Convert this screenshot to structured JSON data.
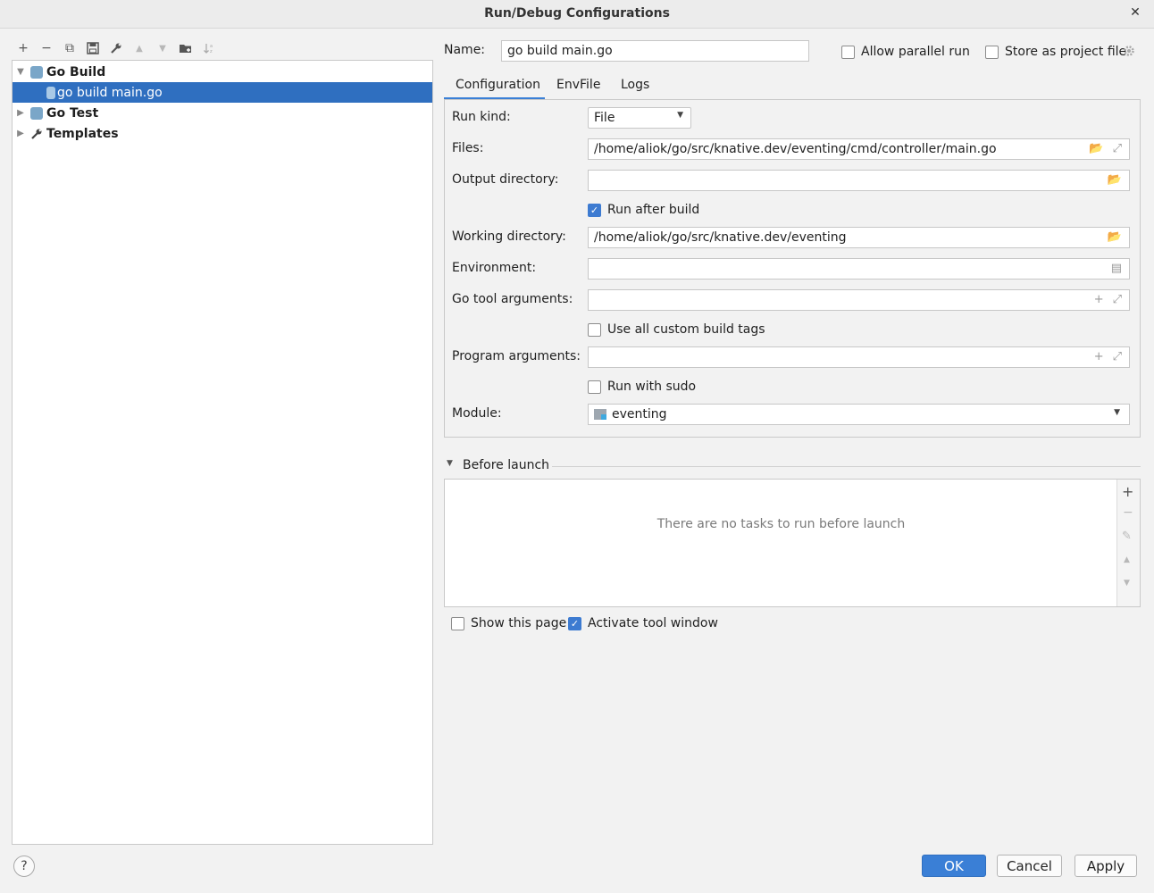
{
  "window": {
    "title": "Run/Debug Configurations",
    "close": "✕"
  },
  "toolbar": {
    "add": "+",
    "remove": "−",
    "copy": "⧉",
    "save": "💾",
    "edit": "🔧",
    "up": "▲",
    "down": "▼",
    "folder": "📁",
    "sort": "↓"
  },
  "tree": {
    "items": [
      {
        "label": "Go Build",
        "arrow": "▼"
      },
      {
        "label": "go build main.go"
      },
      {
        "label": "Go Test",
        "arrow": "▶"
      },
      {
        "label": "Templates",
        "arrow": "▶"
      }
    ]
  },
  "name": {
    "label": "Name:",
    "value": "go build main.go"
  },
  "options": {
    "allow_parallel": "Allow parallel run",
    "store_project": "Store as project file"
  },
  "tabs": [
    "Configuration",
    "EnvFile",
    "Logs"
  ],
  "config": {
    "run_kind_label": "Run kind:",
    "run_kind_value": "File",
    "files_label": "Files:",
    "files_value": "/home/aliok/go/src/knative.dev/eventing/cmd/controller/main.go",
    "output_label": "Output directory:",
    "output_value": "",
    "run_after_build": "Run after build",
    "working_label": "Working directory:",
    "working_value": "/home/aliok/go/src/knative.dev/eventing",
    "env_label": "Environment:",
    "env_value": "",
    "gotool_label": "Go tool arguments:",
    "gotool_value": "",
    "custom_tags": "Use all custom build tags",
    "program_label": "Program arguments:",
    "program_value": "",
    "run_sudo": "Run with sudo",
    "module_label": "Module:",
    "module_value": "eventing"
  },
  "before_launch": {
    "title": "Before launch",
    "empty": "There are no tasks to run before launch",
    "show_page": "Show this page",
    "activate_tool": "Activate tool window"
  },
  "buttons": {
    "help": "?",
    "ok": "OK",
    "cancel": "Cancel",
    "apply": "Apply"
  },
  "colors": {
    "selection": "#2f6fc0",
    "accent": "#3a7fd6"
  }
}
